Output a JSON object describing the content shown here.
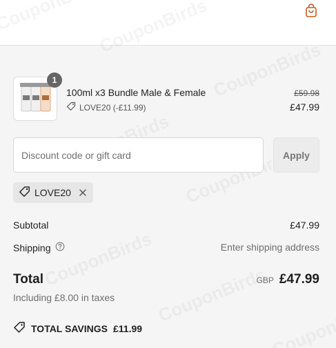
{
  "cart_item": {
    "quantity": "1",
    "name": "100ml x3 Bundle Male & Female",
    "discount": "LOVE20 (-£11.99)",
    "original_price": "£59.98",
    "price": "£47.99"
  },
  "discount_form": {
    "placeholder": "Discount code or gift card",
    "apply_label": "Apply"
  },
  "applied_code": "LOVE20",
  "summary": {
    "subtotal_label": "Subtotal",
    "subtotal_value": "£47.99",
    "shipping_label": "Shipping",
    "shipping_value": "Enter shipping address",
    "total_label": "Total",
    "currency": "GBP",
    "total_value": "£47.99",
    "taxes_note": "Including £8.00 in taxes"
  },
  "savings": {
    "label": "TOTAL SAVINGS",
    "value": "£11.99"
  },
  "watermark": "CouponBirds",
  "icons": {
    "cart": "shopping-bag-icon",
    "tag": "tag-icon",
    "remove": "close-icon",
    "help": "question-circle-icon"
  },
  "colors": {
    "accent": "#c8581c",
    "background": "#f5f5f5",
    "badge": "#666666"
  }
}
